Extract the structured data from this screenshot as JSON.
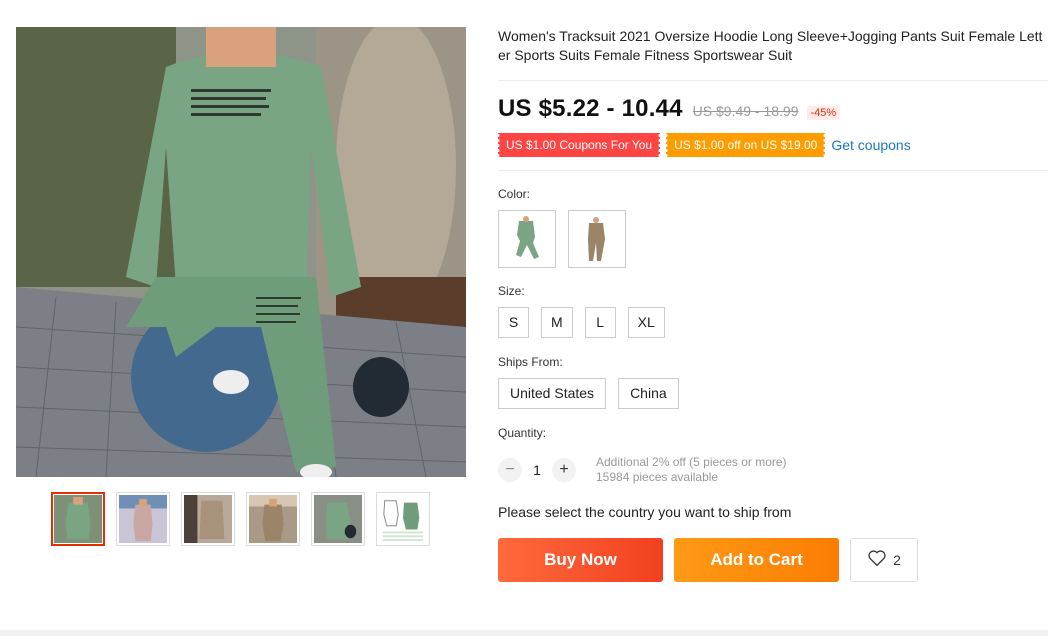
{
  "product": {
    "title": "Women's Tracksuit 2021 Oversize Hoodie Long Sleeve+Jogging Pants Suit Female Letter Sports Suits Female Fitness Sportswear Suit",
    "price": "US $5.22 - 10.44",
    "original_price": "US $9.49 - 18.99",
    "discount": "-45%"
  },
  "coupons": {
    "coupon1": "US $1.00 Coupons For You",
    "coupon2": "US $1.00 off on US $19.00",
    "get_coupons": "Get coupons"
  },
  "color": {
    "label": "Color:",
    "options": [
      "green-tracksuit",
      "khaki-tracksuit"
    ]
  },
  "size": {
    "label": "Size:",
    "options": [
      "S",
      "M",
      "L",
      "XL"
    ]
  },
  "ships_from": {
    "label": "Ships From:",
    "options": [
      "United States",
      "China"
    ]
  },
  "quantity": {
    "label": "Quantity:",
    "value": "1",
    "minus": "−",
    "plus": "+",
    "note_line1": "Additional 2% off (5 pieces or more)",
    "note_line2": "15984 pieces available"
  },
  "ship_message": "Please select the country you want to ship from",
  "actions": {
    "buy_now": "Buy Now",
    "add_to_cart": "Add to Cart",
    "wishlist_count": "2"
  },
  "colors": {
    "price_text": "#111111",
    "discount": "#e62e04",
    "coupon_red": "#ff4444",
    "coupon_orange": "#ff9c00",
    "link": "#1a75c9",
    "buy_now": "#f2401f",
    "add_to_cart": "#fb7d02"
  }
}
